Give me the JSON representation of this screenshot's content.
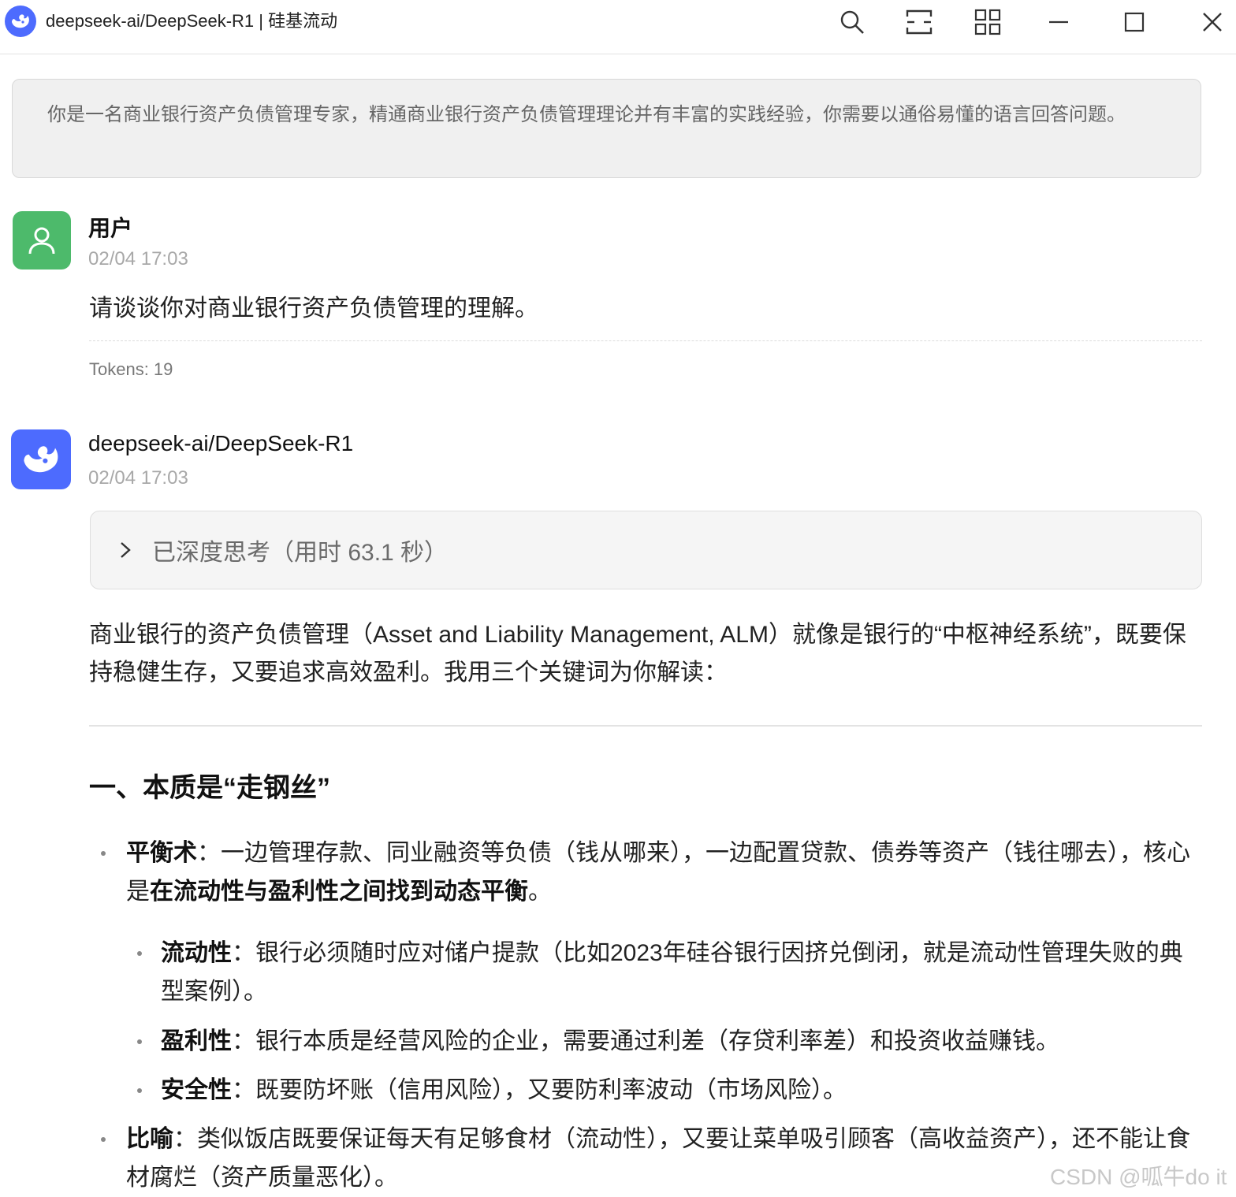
{
  "window": {
    "title": "deepseek-ai/DeepSeek-R1 | 硅基流动",
    "icons": {
      "logo": "deepseek-whale-logo",
      "search": "search-icon",
      "layout": "layout-icon",
      "grid": "grid-icon",
      "minimize": "minimize-icon",
      "maximize": "maximize-icon",
      "close": "close-icon"
    }
  },
  "system_prompt": "你是一名商业银行资产负债管理专家，精通商业银行资产负债管理理论并有丰富的实践经验，你需要以通俗易懂的语言回答问题。",
  "user_message": {
    "name": "用户",
    "time": "02/04 17:03",
    "text": "请谈谈你对商业银行资产负债管理的理解。",
    "tokens": "Tokens: 19"
  },
  "assistant_message": {
    "name": "deepseek-ai/DeepSeek-R1",
    "time": "02/04 17:03",
    "thinking_label": "已深度思考（用时 63.1 秒）",
    "intro": "商业银行的资产负债管理（Asset and Liability Management, ALM）就像是银行的“中枢神经系统”，既要保持稳健生存，又要追求高效盈利。我用三个关键词为你解读：",
    "section_title": "一、本质是“走钢丝”",
    "bullets": {
      "balance": {
        "term": "平衡术",
        "text": "：一边管理存款、同业融资等负债（钱从哪来），一边配置贷款、债券等资产（钱往哪去），核心是",
        "emphasis": "在流动性与盈利性之间找到动态平衡",
        "end": "。"
      },
      "liquidity": {
        "term": "流动性",
        "text": "：银行必须随时应对储户提款（比如2023年硅谷银行因挤兑倒闭，就是流动性管理失败的典型案例）。"
      },
      "profitability": {
        "term": "盈利性",
        "text": "：银行本质是经营风险的企业，需要通过利差（存贷利率差）和投资收益赚钱。"
      },
      "safety": {
        "term": "安全性",
        "text": "：既要防坏账（信用风险），又要防利率波动（市场风险）。"
      },
      "metaphor": {
        "term": "比喻",
        "text": "：类似饭店既要保证每天有足够食材（流动性），又要让菜单吸引顾客（高收益资产），还不能让食材腐烂（资产质量恶化）。"
      }
    }
  },
  "watermark": "CSDN @呱牛do it",
  "colors": {
    "deepseek_blue": "#4d6bfe",
    "user_green": "#4dba6b"
  }
}
